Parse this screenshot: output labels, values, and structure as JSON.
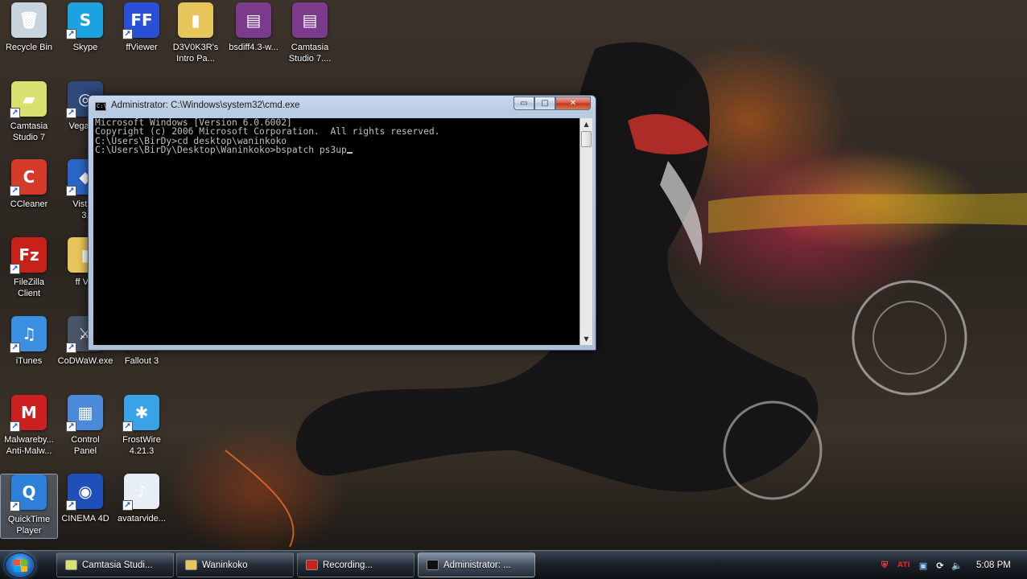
{
  "desktop": {
    "icons": [
      {
        "label": "Recycle Bin",
        "icon": "recycle-bin-icon",
        "color": "#c7d3dd",
        "glyph": "🗑"
      },
      {
        "label": "Skype",
        "icon": "skype-icon",
        "color": "#1aa3e0",
        "glyph": "S"
      },
      {
        "label": "ffViewer",
        "icon": "ffviewer-icon",
        "color": "#2a4fd8",
        "glyph": "FF"
      },
      {
        "label": "D3V0K3R's\nIntro Pa...",
        "icon": "folder-zip-icon",
        "color": "#e6c55a",
        "glyph": "▮"
      },
      {
        "label": "bsdiff4.3-w...",
        "icon": "winrar-icon",
        "color": "#7b3a8c",
        "glyph": "▤"
      },
      {
        "label": "Camtasia\nStudio 7....",
        "icon": "winrar-icon",
        "color": "#7b3a8c",
        "glyph": "▤"
      },
      {
        "label": "Camtasia\nStudio 7",
        "icon": "camtasia-icon",
        "color": "#d8e070",
        "glyph": "▰"
      },
      {
        "label": "Vegas P",
        "icon": "vegas-icon",
        "color": "#2e4a7a",
        "glyph": "◎"
      },
      {
        "label": "CCleaner",
        "icon": "ccleaner-icon",
        "color": "#d63a2a",
        "glyph": "C"
      },
      {
        "label": "VistaB\n3.",
        "icon": "vistab-icon",
        "color": "#2a66c8",
        "glyph": "◆"
      },
      {
        "label": "FileZilla\nClient",
        "icon": "filezilla-icon",
        "color": "#c8211a",
        "glyph": "Fz"
      },
      {
        "label": "ff Vie",
        "icon": "folder-icon",
        "color": "#e6c55a",
        "glyph": "▮"
      },
      {
        "label": "iTunes",
        "icon": "itunes-icon",
        "color": "#3a8fe0",
        "glyph": "♫"
      },
      {
        "label": "CoDWaW.exe",
        "icon": "codwaw-icon",
        "color": "#4a5566",
        "glyph": "⚔"
      },
      {
        "label": "Fallout 3",
        "icon": "fallout-icon",
        "color": "#3a3226",
        "glyph": ""
      },
      {
        "label": "Malwareby...\nAnti-Malw...",
        "icon": "malwarebytes-icon",
        "color": "#cc1f1f",
        "glyph": "M"
      },
      {
        "label": "Control\nPanel",
        "icon": "control-panel-icon",
        "color": "#4a8ad8",
        "glyph": "▦"
      },
      {
        "label": "FrostWire\n4.21.3",
        "icon": "frostwire-icon",
        "color": "#39a3e8",
        "glyph": "✱"
      },
      {
        "label": "QuickTime\nPlayer",
        "icon": "quicktime-icon",
        "color": "#2d7fd8",
        "glyph": "Q"
      },
      {
        "label": "CINEMA 4D",
        "icon": "cinema4d-icon",
        "color": "#1f4fb8",
        "glyph": "◉"
      },
      {
        "label": "avatarvide...",
        "icon": "media-file-icon",
        "color": "#e8eef5",
        "glyph": "♪"
      }
    ]
  },
  "cmd": {
    "title": "Administrator: C:\\Windows\\system32\\cmd.exe",
    "lines": [
      "Microsoft Windows [Version 6.0.6002]",
      "Copyright (c) 2006 Microsoft Corporation.  All rights reserved.",
      "",
      "C:\\Users\\BirDy>cd desktop\\waninkoko",
      "",
      "C:\\Users\\BirDy\\Desktop\\Waninkoko>bspatch ps3up"
    ],
    "minimize_glyph": "▭",
    "maximize_glyph": "□",
    "close_glyph": "✕",
    "scroll_up_glyph": "▲",
    "scroll_down_glyph": "▼"
  },
  "taskbar": {
    "buttons": [
      {
        "label": "Camtasia Studi...",
        "icon": "camtasia-task-icon",
        "color": "#d8e070",
        "active": false
      },
      {
        "label": "Waninkoko",
        "icon": "folder-task-icon",
        "color": "#e6c55a",
        "active": false
      },
      {
        "label": "Recording...",
        "icon": "recording-task-icon",
        "color": "#c8211a",
        "active": false
      },
      {
        "label": "Administrator: ...",
        "icon": "cmd-task-icon",
        "color": "#111111",
        "active": true
      }
    ],
    "tray": {
      "icons": [
        {
          "name": "shield-tray-icon",
          "glyph": "⛨",
          "color": "#e84040"
        },
        {
          "name": "ati-tray-icon",
          "glyph": "ATI",
          "color": "#e82020"
        },
        {
          "name": "network-tray-icon",
          "glyph": "▣",
          "color": "#9ed0ff"
        },
        {
          "name": "refresh-tray-icon",
          "glyph": "⟳",
          "color": "#ffffff"
        },
        {
          "name": "volume-tray-icon",
          "glyph": "🔈",
          "color": "#ffffff"
        }
      ],
      "clock": "5:08 PM"
    }
  }
}
